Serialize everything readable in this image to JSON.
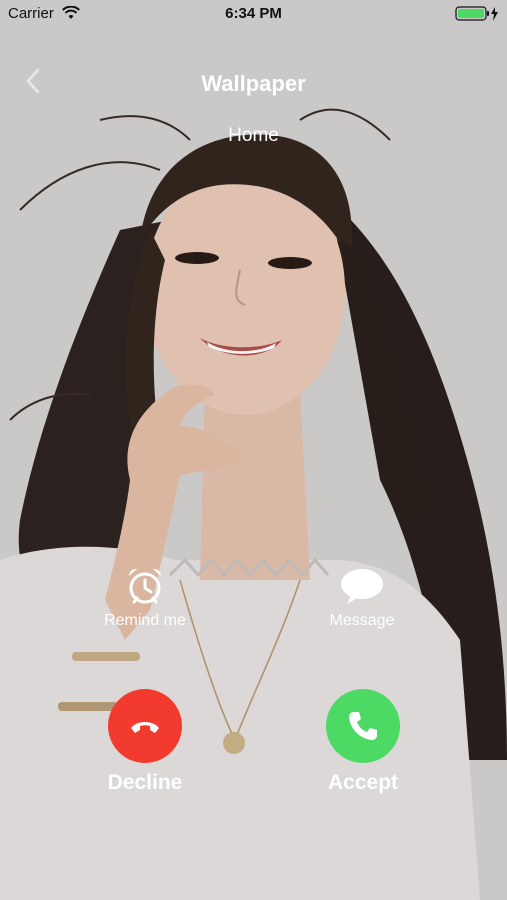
{
  "status_bar": {
    "carrier": "Carrier",
    "time": "6:34 PM"
  },
  "header": {
    "title": "Wallpaper",
    "subtitle": "Home"
  },
  "actions": {
    "remind_label": "Remind me",
    "message_label": "Message"
  },
  "call": {
    "decline_label": "Decline",
    "accept_label": "Accept"
  },
  "colors": {
    "decline": "#f23a2f",
    "accept": "#4cd964",
    "battery": "#4cd964"
  },
  "icons": [
    "wifi-icon",
    "battery-icon",
    "charging-bolt-icon",
    "back-chevron-icon",
    "alarm-clock-icon",
    "speech-bubble-icon",
    "hang-up-phone-icon",
    "phone-icon"
  ]
}
